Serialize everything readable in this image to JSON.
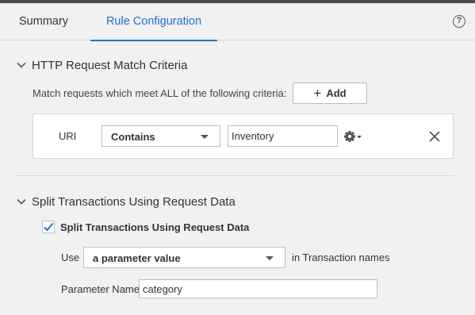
{
  "tabs": {
    "summary": "Summary",
    "rule_configuration": "Rule Configuration"
  },
  "help_icon": "?",
  "http_section": {
    "title": "HTTP Request Match Criteria",
    "description": "Match requests which meet ALL of the following criteria:",
    "add_button": "Add",
    "criteria": {
      "label": "URI",
      "operator": "Contains",
      "value": "Inventory"
    }
  },
  "split_section": {
    "title": "Split Transactions Using Request Data",
    "checkbox_label": "Split Transactions Using Request Data",
    "checked": true,
    "use_label": "Use",
    "use_value": "a parameter value",
    "in_transaction_label": "in Transaction names",
    "parameter_name_label": "Parameter Name",
    "parameter_name_value": "category"
  },
  "colors": {
    "accent": "#1e73c9",
    "topbar": "#4a4a4a",
    "background": "#f1f1f1"
  },
  "icons": [
    "help-icon",
    "chevron-down-icon",
    "plus-icon",
    "caret-down-icon",
    "gear-icon",
    "close-icon",
    "checkmark-icon"
  ]
}
